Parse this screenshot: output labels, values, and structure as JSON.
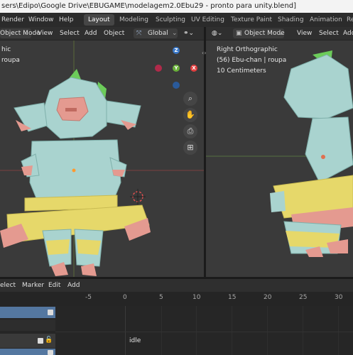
{
  "window": {
    "title": "sers\\Edipo\\Google Drive\\EBUGAME\\modelagem2.0Ebu29 - pronto para unity.blend]"
  },
  "topbar": {
    "menus": [
      "Render",
      "Window",
      "Help"
    ],
    "workspaces": [
      "Layout",
      "Modeling",
      "Sculpting",
      "UV Editing",
      "Texture Paint",
      "Shading",
      "Animation",
      "Re"
    ],
    "active_workspace": "Layout"
  },
  "left_viewport": {
    "header": {
      "mode": "Object Mode",
      "view": "View",
      "select": "Select",
      "add": "Add",
      "object": "Object",
      "orientation": "Global"
    },
    "overlay_lines": [
      "hic",
      "roupa"
    ],
    "gizmo": {
      "z": "Z",
      "y": "Y",
      "x": "X"
    }
  },
  "right_viewport": {
    "header": {
      "mode": "Object Mode",
      "view": "View",
      "select": "Select",
      "add": "Add"
    },
    "overlay_lines": [
      "Right Orthographic",
      "(56) Ebu-chan | roupa",
      "10 Centimeters"
    ]
  },
  "timeline": {
    "header": {
      "select": "elect",
      "marker": "Marker",
      "edit": "Edit",
      "add": "Add"
    },
    "ticks": [
      "-5",
      "0",
      "5",
      "10",
      "15",
      "20",
      "25",
      "30"
    ],
    "action_name": "idle"
  },
  "colors": {
    "model_body": "#a9d3cf",
    "model_skirt": "#e6d86a",
    "model_pink": "#e49a90",
    "model_horn": "#6ccc5a",
    "viewport_bg": "#3a3a3a",
    "track_blue": "#5477a0"
  }
}
